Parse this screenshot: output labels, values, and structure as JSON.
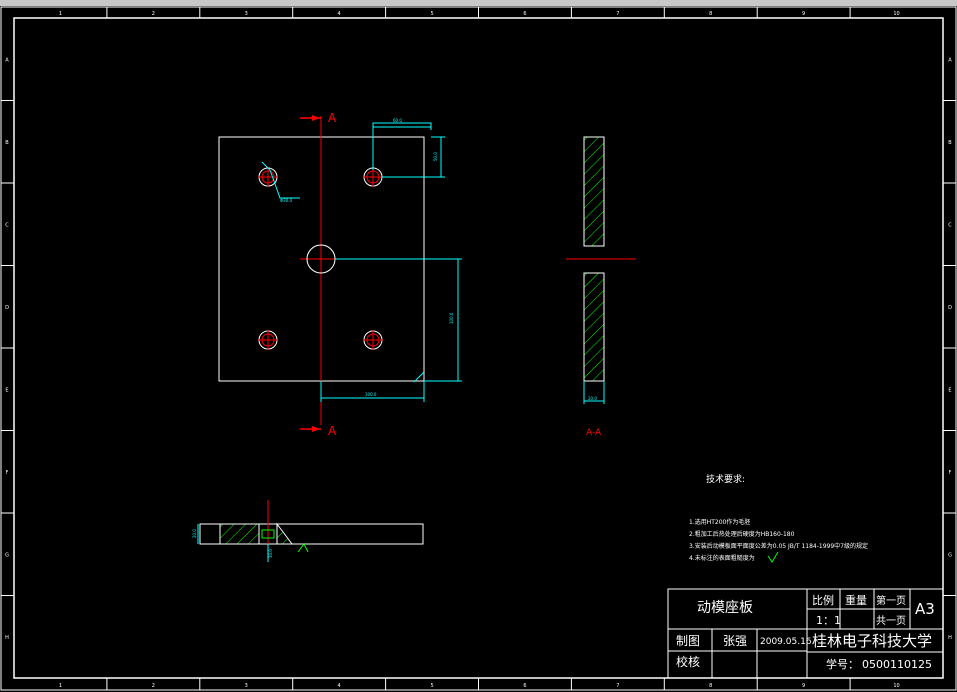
{
  "colors": {
    "background": "#000000",
    "outline": "#ffffff",
    "center_line": "#ff0000",
    "dimension": "#00ffff",
    "hatch": "#00ff00"
  },
  "top_grid_labels": [
    "1",
    "2",
    "3",
    "4",
    "5",
    "6",
    "7",
    "8",
    "9",
    "10"
  ],
  "side_grid_labels": [
    "A",
    "B",
    "C",
    "D",
    "E",
    "F",
    "G",
    "H"
  ],
  "section_marker": "A",
  "section_label": "A-A",
  "tech_requirements": {
    "title": "技术要求:",
    "items": [
      "1.选用HT200作为毛胚",
      "2.粗加工后热处理后硬度为HB160-180",
      "3.安装后动模板面平面度公差为0.05 JB/T 1184-1999中7级的规定",
      "4.未标注的表面粗糙度为"
    ]
  },
  "title_block": {
    "part_name": "动模座板",
    "scale_label": "比例",
    "scale_value": "1：1",
    "weight_label": "重量",
    "sheet_label": "第一页",
    "total_label": "共一页",
    "paper_size": "A3",
    "drawn_label": "制图",
    "drawn_by": "张强",
    "date": "2009.05.16",
    "check_label": "校核",
    "school": "桂林电子科技大学",
    "student_id_label": "学号：",
    "student_id": "0500110125"
  }
}
